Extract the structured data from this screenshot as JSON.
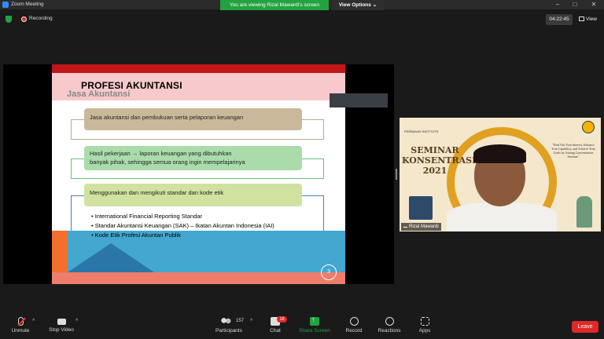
{
  "window": {
    "title": "Zoom Meeting"
  },
  "banner": {
    "viewing": "You are viewing Rizal Mawardi's screen",
    "view_options": "View Options"
  },
  "topbar": {
    "recording": "Recording",
    "clock": "04:22:45",
    "view": "View"
  },
  "slide": {
    "title": "PROFESI AKUNTANSI",
    "subtitle": "Jasa Akuntansi",
    "box1": "Jasa akuntansi dan pembukuan serta pelaporan keuangan",
    "box2_line1": "Hasil pekerjaan → laporan keuangan yang dibutuhkan",
    "box2_line2": "banyak pihak, sehingga semua orang ingin mempelajarinya",
    "box3": "Menggunakan dan mengikuti  standar dan kode etik",
    "bullets": [
      "International Financial Reporting Standar",
      "Standar Akuntansi Keuangan (SAK) – Ikatan Akuntan Indonesia (IAI)",
      "Kode Etik Profesi Akuntan Publik"
    ],
    "page_number": "3",
    "colors": {
      "title_bar": "#c0161a",
      "box1": "#c9b99a",
      "box2": "#a9dcaa",
      "box3": "#cfe2a0"
    }
  },
  "video": {
    "institute": "PERBANAS INSTITUTE",
    "seminar_line1": "SEMINAR",
    "seminar_line2": "KONSENTRASI",
    "seminar_line3": "2021",
    "tagline": "\"Find Out Your Interest, Enhance Your Capability, and Achieve Your Goals by Joining Concentration Seminar\"",
    "participant_name": "Rizal Mawardi"
  },
  "toolbar": {
    "unmute": "Unmute",
    "stop_video": "Stop Video",
    "participants": "Participants",
    "participant_count": "157",
    "chat": "Chat",
    "chat_badge": "18",
    "share_screen": "Share Screen",
    "record": "Record",
    "reactions": "Reactions",
    "apps": "Apps",
    "leave": "Leave"
  }
}
